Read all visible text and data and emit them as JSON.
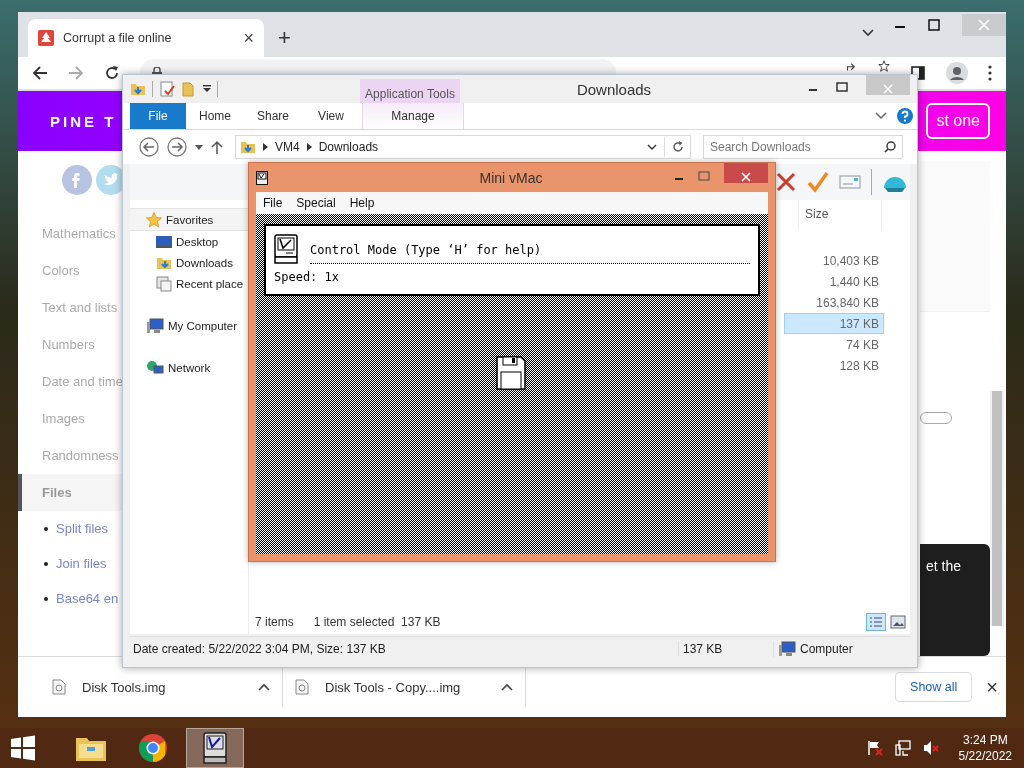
{
  "browser": {
    "tab": {
      "title": "Corrupt a file online",
      "close": "×"
    },
    "new_tab": "+",
    "banner": {
      "logo": "PINE T",
      "button": "st one"
    },
    "sidebar": [
      {
        "label": "Mathematics",
        "selected": false
      },
      {
        "label": "Colors",
        "selected": false
      },
      {
        "label": "Text and lists",
        "selected": false
      },
      {
        "label": "Numbers",
        "selected": false
      },
      {
        "label": "Date and time",
        "selected": false
      },
      {
        "label": "Images",
        "selected": false
      },
      {
        "label": "Randomness",
        "selected": false
      },
      {
        "label": "Files",
        "selected": true,
        "children": [
          {
            "label": "Split files"
          },
          {
            "label": "Join files"
          },
          {
            "label": "Base64 en"
          }
        ]
      }
    ],
    "card_text": "et the",
    "downloads": [
      {
        "name": "Disk Tools.img"
      },
      {
        "name": "Disk Tools - Copy....img"
      }
    ],
    "show_all": "Show all",
    "close_downloads": "×"
  },
  "explorer": {
    "title": "Downloads",
    "context_tab": "Application Tools",
    "ribbon_tabs": [
      {
        "label": "File",
        "kind": "file"
      },
      {
        "label": "Home",
        "kind": "tab"
      },
      {
        "label": "Share",
        "kind": "tab"
      },
      {
        "label": "View",
        "kind": "tab"
      },
      {
        "label": "Manage",
        "kind": "context"
      }
    ],
    "path": [
      "VM4",
      "Downloads"
    ],
    "search": {
      "placeholder": "Search Downloads"
    },
    "nav": [
      {
        "label": "Favorites",
        "kind": "star",
        "children": [
          {
            "label": "Desktop",
            "kind": "desktop"
          },
          {
            "label": "Downloads",
            "kind": "folder"
          },
          {
            "label": "Recent place",
            "kind": "recent"
          }
        ]
      },
      {
        "label": "My Computer",
        "kind": "computer"
      },
      {
        "label": "Network",
        "kind": "network"
      }
    ],
    "column": "Size",
    "rows": [
      {
        "size": "10,403 KB",
        "selected": false
      },
      {
        "size": "1,440 KB",
        "selected": false
      },
      {
        "size": "163,840 KB",
        "selected": false
      },
      {
        "size": "137 KB",
        "selected": true
      },
      {
        "size": "74 KB",
        "selected": false
      },
      {
        "size": "128 KB",
        "selected": false
      }
    ],
    "status": {
      "count": "7 items",
      "selection": "1 item selected  137 KB"
    },
    "details": {
      "info": "Date created: 5/22/2022 3:04 PM, Size: 137 KB",
      "size": "137 KB",
      "location": "Computer"
    }
  },
  "emulator": {
    "title": "Mini vMac",
    "menu": [
      "File",
      "Special",
      "Help"
    ],
    "message": "Control Mode (Type ‘H’ for help)",
    "speed": "Speed: 1x"
  },
  "taskbar": {
    "apps": [
      {
        "kind": "explorer",
        "selected": false
      },
      {
        "kind": "chrome",
        "selected": false
      },
      {
        "kind": "vmac",
        "selected": true
      }
    ],
    "time": "3:24 PM",
    "date": "5/22/2022"
  }
}
